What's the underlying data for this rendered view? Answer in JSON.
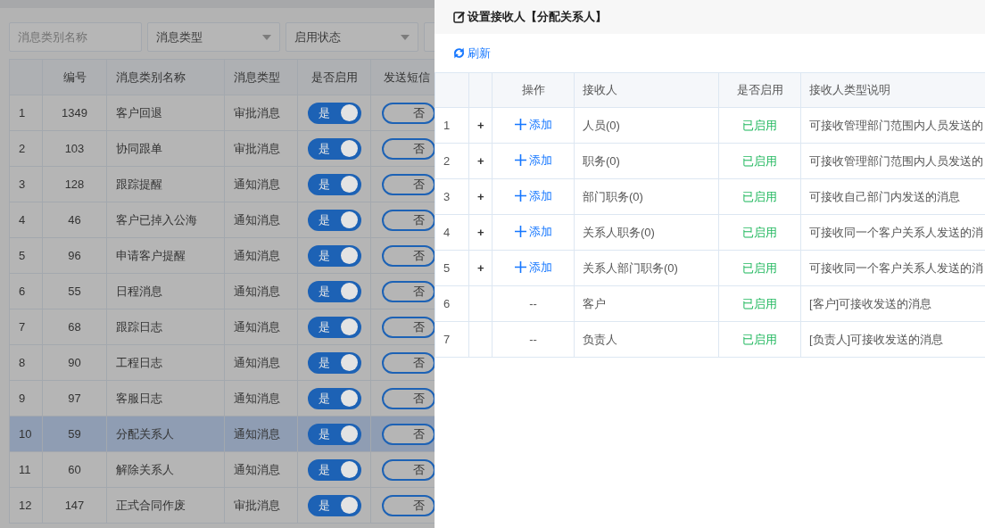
{
  "filters": [
    {
      "kind": "input",
      "placeholder": "消息类别名称"
    },
    {
      "kind": "select",
      "value": "消息类型"
    },
    {
      "kind": "select",
      "value": "启用状态"
    },
    {
      "kind": "select"
    }
  ],
  "message_table": {
    "columns": [
      "编号",
      "消息类别名称",
      "消息类型",
      "是否启用",
      "发送短信"
    ],
    "rows": [
      {
        "index": "1",
        "id": "1349",
        "name": "客户回退",
        "type": "审批消息",
        "enabled": {
          "on": true,
          "label": "是"
        },
        "sms": {
          "on": false,
          "label": "否"
        },
        "selected": false
      },
      {
        "index": "2",
        "id": "103",
        "name": "协同跟单",
        "type": "审批消息",
        "enabled": {
          "on": true,
          "label": "是"
        },
        "sms": {
          "on": false,
          "label": "否"
        },
        "selected": false
      },
      {
        "index": "3",
        "id": "128",
        "name": "跟踪提醒",
        "type": "通知消息",
        "enabled": {
          "on": true,
          "label": "是"
        },
        "sms": {
          "on": false,
          "label": "否"
        },
        "selected": false
      },
      {
        "index": "4",
        "id": "46",
        "name": "客户已掉入公海",
        "type": "通知消息",
        "enabled": {
          "on": true,
          "label": "是"
        },
        "sms": {
          "on": false,
          "label": "否"
        },
        "selected": false
      },
      {
        "index": "5",
        "id": "96",
        "name": "申请客户提醒",
        "type": "通知消息",
        "enabled": {
          "on": true,
          "label": "是"
        },
        "sms": {
          "on": false,
          "label": "否"
        },
        "selected": false
      },
      {
        "index": "6",
        "id": "55",
        "name": "日程消息",
        "type": "通知消息",
        "enabled": {
          "on": true,
          "label": "是"
        },
        "sms": {
          "on": false,
          "label": "否"
        },
        "selected": false
      },
      {
        "index": "7",
        "id": "68",
        "name": "跟踪日志",
        "type": "通知消息",
        "enabled": {
          "on": true,
          "label": "是"
        },
        "sms": {
          "on": false,
          "label": "否"
        },
        "selected": false
      },
      {
        "index": "8",
        "id": "90",
        "name": "工程日志",
        "type": "通知消息",
        "enabled": {
          "on": true,
          "label": "是"
        },
        "sms": {
          "on": false,
          "label": "否"
        },
        "selected": false
      },
      {
        "index": "9",
        "id": "97",
        "name": "客服日志",
        "type": "通知消息",
        "enabled": {
          "on": true,
          "label": "是"
        },
        "sms": {
          "on": false,
          "label": "否"
        },
        "selected": false
      },
      {
        "index": "10",
        "id": "59",
        "name": "分配关系人",
        "type": "通知消息",
        "enabled": {
          "on": true,
          "label": "是"
        },
        "sms": {
          "on": false,
          "label": "否"
        },
        "selected": true
      },
      {
        "index": "11",
        "id": "60",
        "name": "解除关系人",
        "type": "通知消息",
        "enabled": {
          "on": true,
          "label": "是"
        },
        "sms": {
          "on": false,
          "label": "否"
        },
        "selected": false
      },
      {
        "index": "12",
        "id": "147",
        "name": "正式合同作废",
        "type": "审批消息",
        "enabled": {
          "on": true,
          "label": "是"
        },
        "sms": {
          "on": false,
          "label": "否"
        },
        "selected": false
      }
    ]
  },
  "drawer": {
    "title": "设置接收人【分配关系人】",
    "refresh": "刷新",
    "table": {
      "columns": [
        "操作",
        "接收人",
        "是否启用",
        "接收人类型说明"
      ],
      "rows": [
        {
          "kind": "addable",
          "index": "1",
          "expand": "+",
          "action": "添加",
          "receiver": "人员(0)",
          "status": "已启用",
          "description": "可接收管理部门范围内人员发送的"
        },
        {
          "kind": "addable",
          "index": "2",
          "expand": "+",
          "action": "添加",
          "receiver": "职务(0)",
          "status": "已启用",
          "description": "可接收管理部门范围内人员发送的"
        },
        {
          "kind": "addable",
          "index": "3",
          "expand": "+",
          "action": "添加",
          "receiver": "部门职务(0)",
          "status": "已启用",
          "description": "可接收自己部门内发送的消息"
        },
        {
          "kind": "addable",
          "index": "4",
          "expand": "+",
          "action": "添加",
          "receiver": "关系人职务(0)",
          "status": "已启用",
          "description": "可接收同一个客户关系人发送的消"
        },
        {
          "kind": "addable",
          "index": "5",
          "expand": "+",
          "action": "添加",
          "receiver": "关系人部门职务(0)",
          "status": "已启用",
          "description": "可接收同一个客户关系人发送的消"
        },
        {
          "kind": "fixed",
          "index": "6",
          "action": "--",
          "receiver": "客户",
          "status": "已启用",
          "description": "[客户]可接收发送的消息"
        },
        {
          "kind": "fixed",
          "index": "7",
          "action": "--",
          "receiver": "负责人",
          "status": "已启用",
          "description": "[负责人]可接收发送的消息"
        }
      ]
    }
  }
}
